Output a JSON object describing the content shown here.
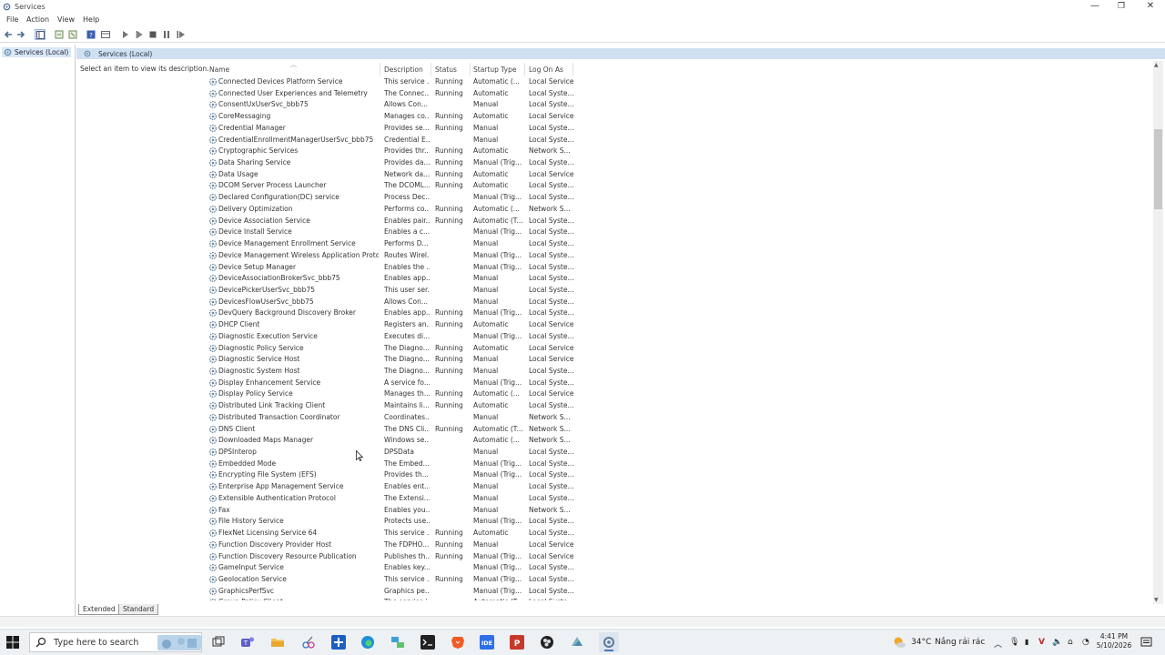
{
  "window": {
    "title": "Services"
  },
  "menu": [
    "File",
    "Action",
    "View",
    "Help"
  ],
  "tree": {
    "root": "Services (Local)"
  },
  "panel": {
    "header": "Services (Local)",
    "hint": "Select an item to view its description."
  },
  "columns": {
    "name": "Name",
    "description": "Description",
    "status": "Status",
    "startup": "Startup Type",
    "logon": "Log On As"
  },
  "services": [
    [
      "Connected Devices Platform Service",
      "This service ...",
      "Running",
      "Automatic (...",
      "Local Service"
    ],
    [
      "Connected User Experiences and Telemetry",
      "The Connec...",
      "Running",
      "Automatic",
      "Local Syste..."
    ],
    [
      "ConsentUxUserSvc_bbb75",
      "Allows Con...",
      "",
      "Manual",
      "Local Syste..."
    ],
    [
      "CoreMessaging",
      "Manages co...",
      "Running",
      "Automatic",
      "Local Service"
    ],
    [
      "Credential Manager",
      "Provides se...",
      "Running",
      "Manual",
      "Local Syste..."
    ],
    [
      "CredentialEnrollmentManagerUserSvc_bbb75",
      "Credential E...",
      "",
      "Manual",
      "Local Syste..."
    ],
    [
      "Cryptographic Services",
      "Provides thr...",
      "Running",
      "Automatic",
      "Network S..."
    ],
    [
      "Data Sharing Service",
      "Provides da...",
      "Running",
      "Manual (Trig...",
      "Local Syste..."
    ],
    [
      "Data Usage",
      "Network da...",
      "Running",
      "Automatic",
      "Local Service"
    ],
    [
      "DCOM Server Process Launcher",
      "The DCOML...",
      "Running",
      "Automatic",
      "Local Syste..."
    ],
    [
      "Declared Configuration(DC) service",
      "Process Dec...",
      "",
      "Manual (Trig...",
      "Local Syste..."
    ],
    [
      "Delivery Optimization",
      "Performs co...",
      "Running",
      "Automatic (...",
      "Network S..."
    ],
    [
      "Device Association Service",
      "Enables pair...",
      "Running",
      "Automatic (T...",
      "Local Syste..."
    ],
    [
      "Device Install Service",
      "Enables a c...",
      "",
      "Manual (Trig...",
      "Local Syste..."
    ],
    [
      "Device Management Enrollment Service",
      "Performs D...",
      "",
      "Manual",
      "Local Syste..."
    ],
    [
      "Device Management Wireless Application Proto...",
      "Routes Wirel...",
      "",
      "Manual (Trig...",
      "Local Syste..."
    ],
    [
      "Device Setup Manager",
      "Enables the ...",
      "",
      "Manual (Trig...",
      "Local Syste..."
    ],
    [
      "DeviceAssociationBrokerSvc_bbb75",
      "Enables app...",
      "",
      "Manual",
      "Local Syste..."
    ],
    [
      "DevicePickerUserSvc_bbb75",
      "This user ser...",
      "",
      "Manual",
      "Local Syste..."
    ],
    [
      "DevicesFlowUserSvc_bbb75",
      "Allows Con...",
      "",
      "Manual",
      "Local Syste..."
    ],
    [
      "DevQuery Background Discovery Broker",
      "Enables app...",
      "Running",
      "Manual (Trig...",
      "Local Syste..."
    ],
    [
      "DHCP Client",
      "Registers an...",
      "Running",
      "Automatic",
      "Local Service"
    ],
    [
      "Diagnostic Execution Service",
      "Executes di...",
      "",
      "Manual (Trig...",
      "Local Syste..."
    ],
    [
      "Diagnostic Policy Service",
      "The Diagno...",
      "Running",
      "Automatic",
      "Local Service"
    ],
    [
      "Diagnostic Service Host",
      "The Diagno...",
      "Running",
      "Manual",
      "Local Service"
    ],
    [
      "Diagnostic System Host",
      "The Diagno...",
      "Running",
      "Manual",
      "Local Syste..."
    ],
    [
      "Display Enhancement Service",
      "A service fo...",
      "",
      "Manual (Trig...",
      "Local Syste..."
    ],
    [
      "Display Policy Service",
      "Manages th...",
      "Running",
      "Automatic (...",
      "Local Service"
    ],
    [
      "Distributed Link Tracking Client",
      "Maintains li...",
      "Running",
      "Automatic",
      "Local Syste..."
    ],
    [
      "Distributed Transaction Coordinator",
      "Coordinates...",
      "",
      "Manual",
      "Network S..."
    ],
    [
      "DNS Client",
      "The DNS Cli...",
      "Running",
      "Automatic (T...",
      "Network S..."
    ],
    [
      "Downloaded Maps Manager",
      "Windows se...",
      "",
      "Automatic (...",
      "Network S..."
    ],
    [
      "DPSInterop",
      "DPSData",
      "",
      "Manual",
      "Local Syste..."
    ],
    [
      "Embedded Mode",
      "The Embed...",
      "",
      "Manual (Trig...",
      "Local Syste..."
    ],
    [
      "Encrypting File System (EFS)",
      "Provides th...",
      "",
      "Manual (Trig...",
      "Local Syste..."
    ],
    [
      "Enterprise App Management Service",
      "Enables ent...",
      "",
      "Manual",
      "Local Syste..."
    ],
    [
      "Extensible Authentication Protocol",
      "The Extensi...",
      "",
      "Manual",
      "Local Syste..."
    ],
    [
      "Fax",
      "Enables you...",
      "",
      "Manual",
      "Network S..."
    ],
    [
      "File History Service",
      "Protects use...",
      "",
      "Manual (Trig...",
      "Local Syste..."
    ],
    [
      "FlexNet Licensing Service 64",
      "This service ...",
      "Running",
      "Automatic",
      "Local Syste..."
    ],
    [
      "Function Discovery Provider Host",
      "The FDPHO...",
      "Running",
      "Manual",
      "Local Service"
    ],
    [
      "Function Discovery Resource Publication",
      "Publishes th...",
      "Running",
      "Manual (Trig...",
      "Local Service"
    ],
    [
      "GameInput Service",
      "Enables key...",
      "",
      "Manual (Trig...",
      "Local Syste..."
    ],
    [
      "Geolocation Service",
      "This service ...",
      "Running",
      "Manual (Trig...",
      "Local Syste..."
    ],
    [
      "GraphicsPerfSvc",
      "Graphics pe...",
      "",
      "Manual (Trig...",
      "Local Syste..."
    ],
    [
      "Group Policy Client",
      "The service i...",
      "",
      "Automatic (T...",
      "Local Syste..."
    ]
  ],
  "tabs": {
    "extended": "Extended",
    "standard": "Standard"
  },
  "taskbar": {
    "search_placeholder": "Type here to search",
    "weather_temp": "34°C",
    "weather_text": "Nắng rải rác",
    "time": "4:41 PM",
    "date": "5/10/2026"
  },
  "colors": {
    "header_bg": "#cfe0f2",
    "selection_bg": "#d9e8f7",
    "taskbar_bg": "#eef1f4"
  }
}
